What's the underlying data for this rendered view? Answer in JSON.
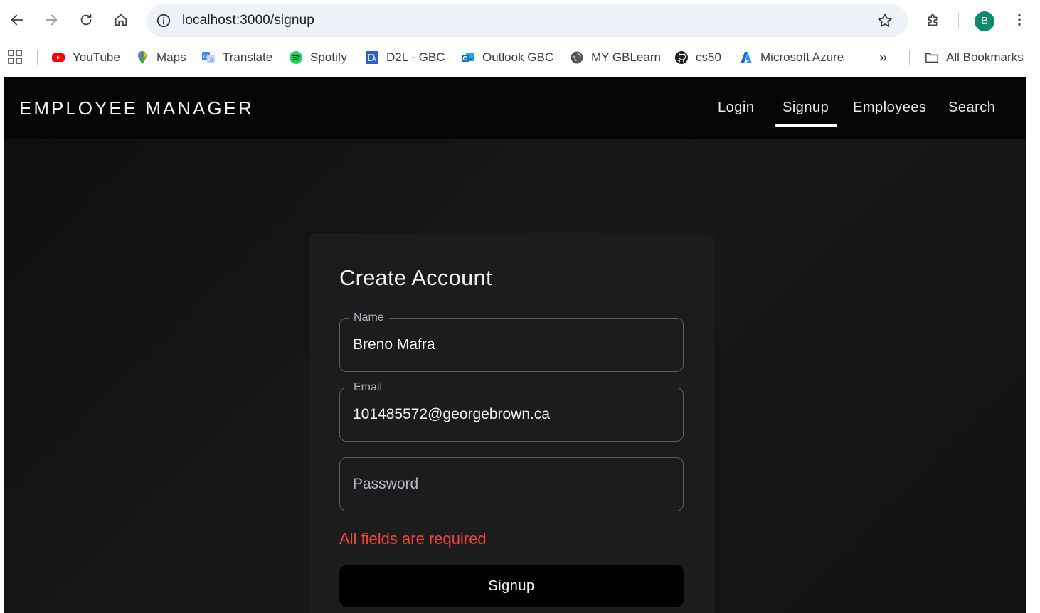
{
  "browser": {
    "url": "localhost:3000/signup",
    "profile_initial": "B",
    "bookmarks": [
      {
        "label": "YouTube",
        "icon": "youtube-icon"
      },
      {
        "label": "Maps",
        "icon": "maps-pin-icon"
      },
      {
        "label": "Translate",
        "icon": "translate-icon"
      },
      {
        "label": "Spotify",
        "icon": "spotify-icon"
      },
      {
        "label": "D2L - GBC",
        "icon": "d2l-icon"
      },
      {
        "label": "Outlook GBC",
        "icon": "outlook-icon"
      },
      {
        "label": "MY GBLearn",
        "icon": "globe-icon"
      },
      {
        "label": "cs50",
        "icon": "github-icon"
      },
      {
        "label": "Microsoft Azure",
        "icon": "azure-icon"
      }
    ],
    "overflow_label": "»",
    "all_bookmarks_label": "All Bookmarks"
  },
  "app": {
    "brand": "EMPLOYEE MANAGER",
    "nav": [
      {
        "label": "Login",
        "active": false
      },
      {
        "label": "Signup",
        "active": true
      },
      {
        "label": "Employees",
        "active": false
      },
      {
        "label": "Search",
        "active": false
      }
    ]
  },
  "form": {
    "title": "Create Account",
    "name": {
      "label": "Name",
      "value": "Breno Mafra"
    },
    "email": {
      "label": "Email",
      "value": "101485572@georgebrown.ca"
    },
    "password": {
      "placeholder": "Password",
      "value": ""
    },
    "error": "All fields are required",
    "submit_label": "Signup"
  },
  "colors": {
    "accent_avatar": "#0f8a6b",
    "error": "#f44336",
    "appbar": "#050505",
    "card": "#1b1c1e"
  }
}
